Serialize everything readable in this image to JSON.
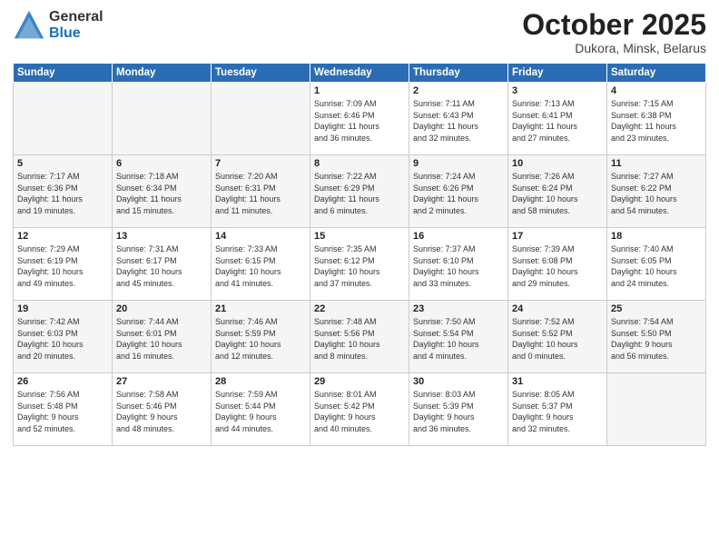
{
  "header": {
    "logo_general": "General",
    "logo_blue": "Blue",
    "month_title": "October 2025",
    "location": "Dukora, Minsk, Belarus"
  },
  "days_of_week": [
    "Sunday",
    "Monday",
    "Tuesday",
    "Wednesday",
    "Thursday",
    "Friday",
    "Saturday"
  ],
  "weeks": [
    [
      {
        "day": "",
        "info": "",
        "empty": true
      },
      {
        "day": "",
        "info": "",
        "empty": true
      },
      {
        "day": "",
        "info": "",
        "empty": true
      },
      {
        "day": "1",
        "info": "Sunrise: 7:09 AM\nSunset: 6:46 PM\nDaylight: 11 hours\nand 36 minutes."
      },
      {
        "day": "2",
        "info": "Sunrise: 7:11 AM\nSunset: 6:43 PM\nDaylight: 11 hours\nand 32 minutes."
      },
      {
        "day": "3",
        "info": "Sunrise: 7:13 AM\nSunset: 6:41 PM\nDaylight: 11 hours\nand 27 minutes."
      },
      {
        "day": "4",
        "info": "Sunrise: 7:15 AM\nSunset: 6:38 PM\nDaylight: 11 hours\nand 23 minutes."
      }
    ],
    [
      {
        "day": "5",
        "info": "Sunrise: 7:17 AM\nSunset: 6:36 PM\nDaylight: 11 hours\nand 19 minutes."
      },
      {
        "day": "6",
        "info": "Sunrise: 7:18 AM\nSunset: 6:34 PM\nDaylight: 11 hours\nand 15 minutes."
      },
      {
        "day": "7",
        "info": "Sunrise: 7:20 AM\nSunset: 6:31 PM\nDaylight: 11 hours\nand 11 minutes."
      },
      {
        "day": "8",
        "info": "Sunrise: 7:22 AM\nSunset: 6:29 PM\nDaylight: 11 hours\nand 6 minutes."
      },
      {
        "day": "9",
        "info": "Sunrise: 7:24 AM\nSunset: 6:26 PM\nDaylight: 11 hours\nand 2 minutes."
      },
      {
        "day": "10",
        "info": "Sunrise: 7:26 AM\nSunset: 6:24 PM\nDaylight: 10 hours\nand 58 minutes."
      },
      {
        "day": "11",
        "info": "Sunrise: 7:27 AM\nSunset: 6:22 PM\nDaylight: 10 hours\nand 54 minutes."
      }
    ],
    [
      {
        "day": "12",
        "info": "Sunrise: 7:29 AM\nSunset: 6:19 PM\nDaylight: 10 hours\nand 49 minutes."
      },
      {
        "day": "13",
        "info": "Sunrise: 7:31 AM\nSunset: 6:17 PM\nDaylight: 10 hours\nand 45 minutes."
      },
      {
        "day": "14",
        "info": "Sunrise: 7:33 AM\nSunset: 6:15 PM\nDaylight: 10 hours\nand 41 minutes."
      },
      {
        "day": "15",
        "info": "Sunrise: 7:35 AM\nSunset: 6:12 PM\nDaylight: 10 hours\nand 37 minutes."
      },
      {
        "day": "16",
        "info": "Sunrise: 7:37 AM\nSunset: 6:10 PM\nDaylight: 10 hours\nand 33 minutes."
      },
      {
        "day": "17",
        "info": "Sunrise: 7:39 AM\nSunset: 6:08 PM\nDaylight: 10 hours\nand 29 minutes."
      },
      {
        "day": "18",
        "info": "Sunrise: 7:40 AM\nSunset: 6:05 PM\nDaylight: 10 hours\nand 24 minutes."
      }
    ],
    [
      {
        "day": "19",
        "info": "Sunrise: 7:42 AM\nSunset: 6:03 PM\nDaylight: 10 hours\nand 20 minutes."
      },
      {
        "day": "20",
        "info": "Sunrise: 7:44 AM\nSunset: 6:01 PM\nDaylight: 10 hours\nand 16 minutes."
      },
      {
        "day": "21",
        "info": "Sunrise: 7:46 AM\nSunset: 5:59 PM\nDaylight: 10 hours\nand 12 minutes."
      },
      {
        "day": "22",
        "info": "Sunrise: 7:48 AM\nSunset: 5:56 PM\nDaylight: 10 hours\nand 8 minutes."
      },
      {
        "day": "23",
        "info": "Sunrise: 7:50 AM\nSunset: 5:54 PM\nDaylight: 10 hours\nand 4 minutes."
      },
      {
        "day": "24",
        "info": "Sunrise: 7:52 AM\nSunset: 5:52 PM\nDaylight: 10 hours\nand 0 minutes."
      },
      {
        "day": "25",
        "info": "Sunrise: 7:54 AM\nSunset: 5:50 PM\nDaylight: 9 hours\nand 56 minutes."
      }
    ],
    [
      {
        "day": "26",
        "info": "Sunrise: 7:56 AM\nSunset: 5:48 PM\nDaylight: 9 hours\nand 52 minutes."
      },
      {
        "day": "27",
        "info": "Sunrise: 7:58 AM\nSunset: 5:46 PM\nDaylight: 9 hours\nand 48 minutes."
      },
      {
        "day": "28",
        "info": "Sunrise: 7:59 AM\nSunset: 5:44 PM\nDaylight: 9 hours\nand 44 minutes."
      },
      {
        "day": "29",
        "info": "Sunrise: 8:01 AM\nSunset: 5:42 PM\nDaylight: 9 hours\nand 40 minutes."
      },
      {
        "day": "30",
        "info": "Sunrise: 8:03 AM\nSunset: 5:39 PM\nDaylight: 9 hours\nand 36 minutes."
      },
      {
        "day": "31",
        "info": "Sunrise: 8:05 AM\nSunset: 5:37 PM\nDaylight: 9 hours\nand 32 minutes."
      },
      {
        "day": "",
        "info": "",
        "empty": true
      }
    ]
  ]
}
